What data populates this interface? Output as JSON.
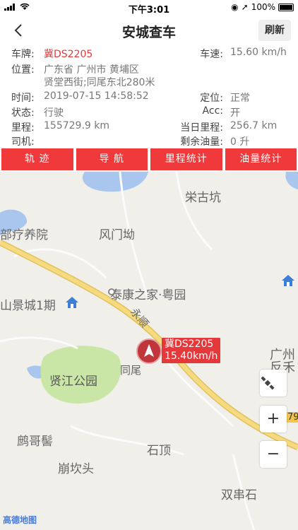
{
  "status_bar": {
    "time": "下午3:01",
    "battery": "100%"
  },
  "nav": {
    "title": "安城查车",
    "refresh_label": "刷新"
  },
  "info": {
    "plate_label": "车牌:",
    "plate_value": "冀DS2205",
    "speed_label": "车速:",
    "speed_value": "15.60 km/h",
    "location_label": "位置:",
    "location_line1": "广东省 广州市 黄埔区",
    "location_line2": "贤堂西街;同尾东北280米",
    "time_label": "时间:",
    "time_value": "2019-07-15 14:58:52",
    "gps_label": "定位:",
    "gps_value": "正常",
    "state_label": "状态:",
    "state_value": "行驶",
    "acc_label": "Acc:",
    "acc_value": "开",
    "mileage_label": "里程:",
    "mileage_value": "155729.9 km",
    "daily_label": "当日里程:",
    "daily_value": "256.7 km",
    "driver_label": "司机:",
    "driver_value": "",
    "fuel_label": "剩余油量:",
    "fuel_value": "0 升"
  },
  "actions": [
    "轨 迹",
    "导 航",
    "里程统计",
    "油量统计"
  ],
  "map": {
    "places": {
      "p1": "栄古坑",
      "p2": "部疗养院",
      "p3": "风门坳",
      "p4": "泰康之家·粤园",
      "p5": "山景城1期",
      "p6": "永顺",
      "p7": "贤江公园",
      "p8": "同尾",
      "p9": "鹧哥髻",
      "p10": "石顶",
      "p11": "崩坎头",
      "p12": "双串石",
      "p13": "广州",
      "p14": "反禾",
      "p15": "79"
    },
    "car_plate": "冀DS2205",
    "car_speed": "15.40km/h",
    "zoom_in": "+",
    "zoom_out": "−",
    "logo": "高德地图"
  }
}
